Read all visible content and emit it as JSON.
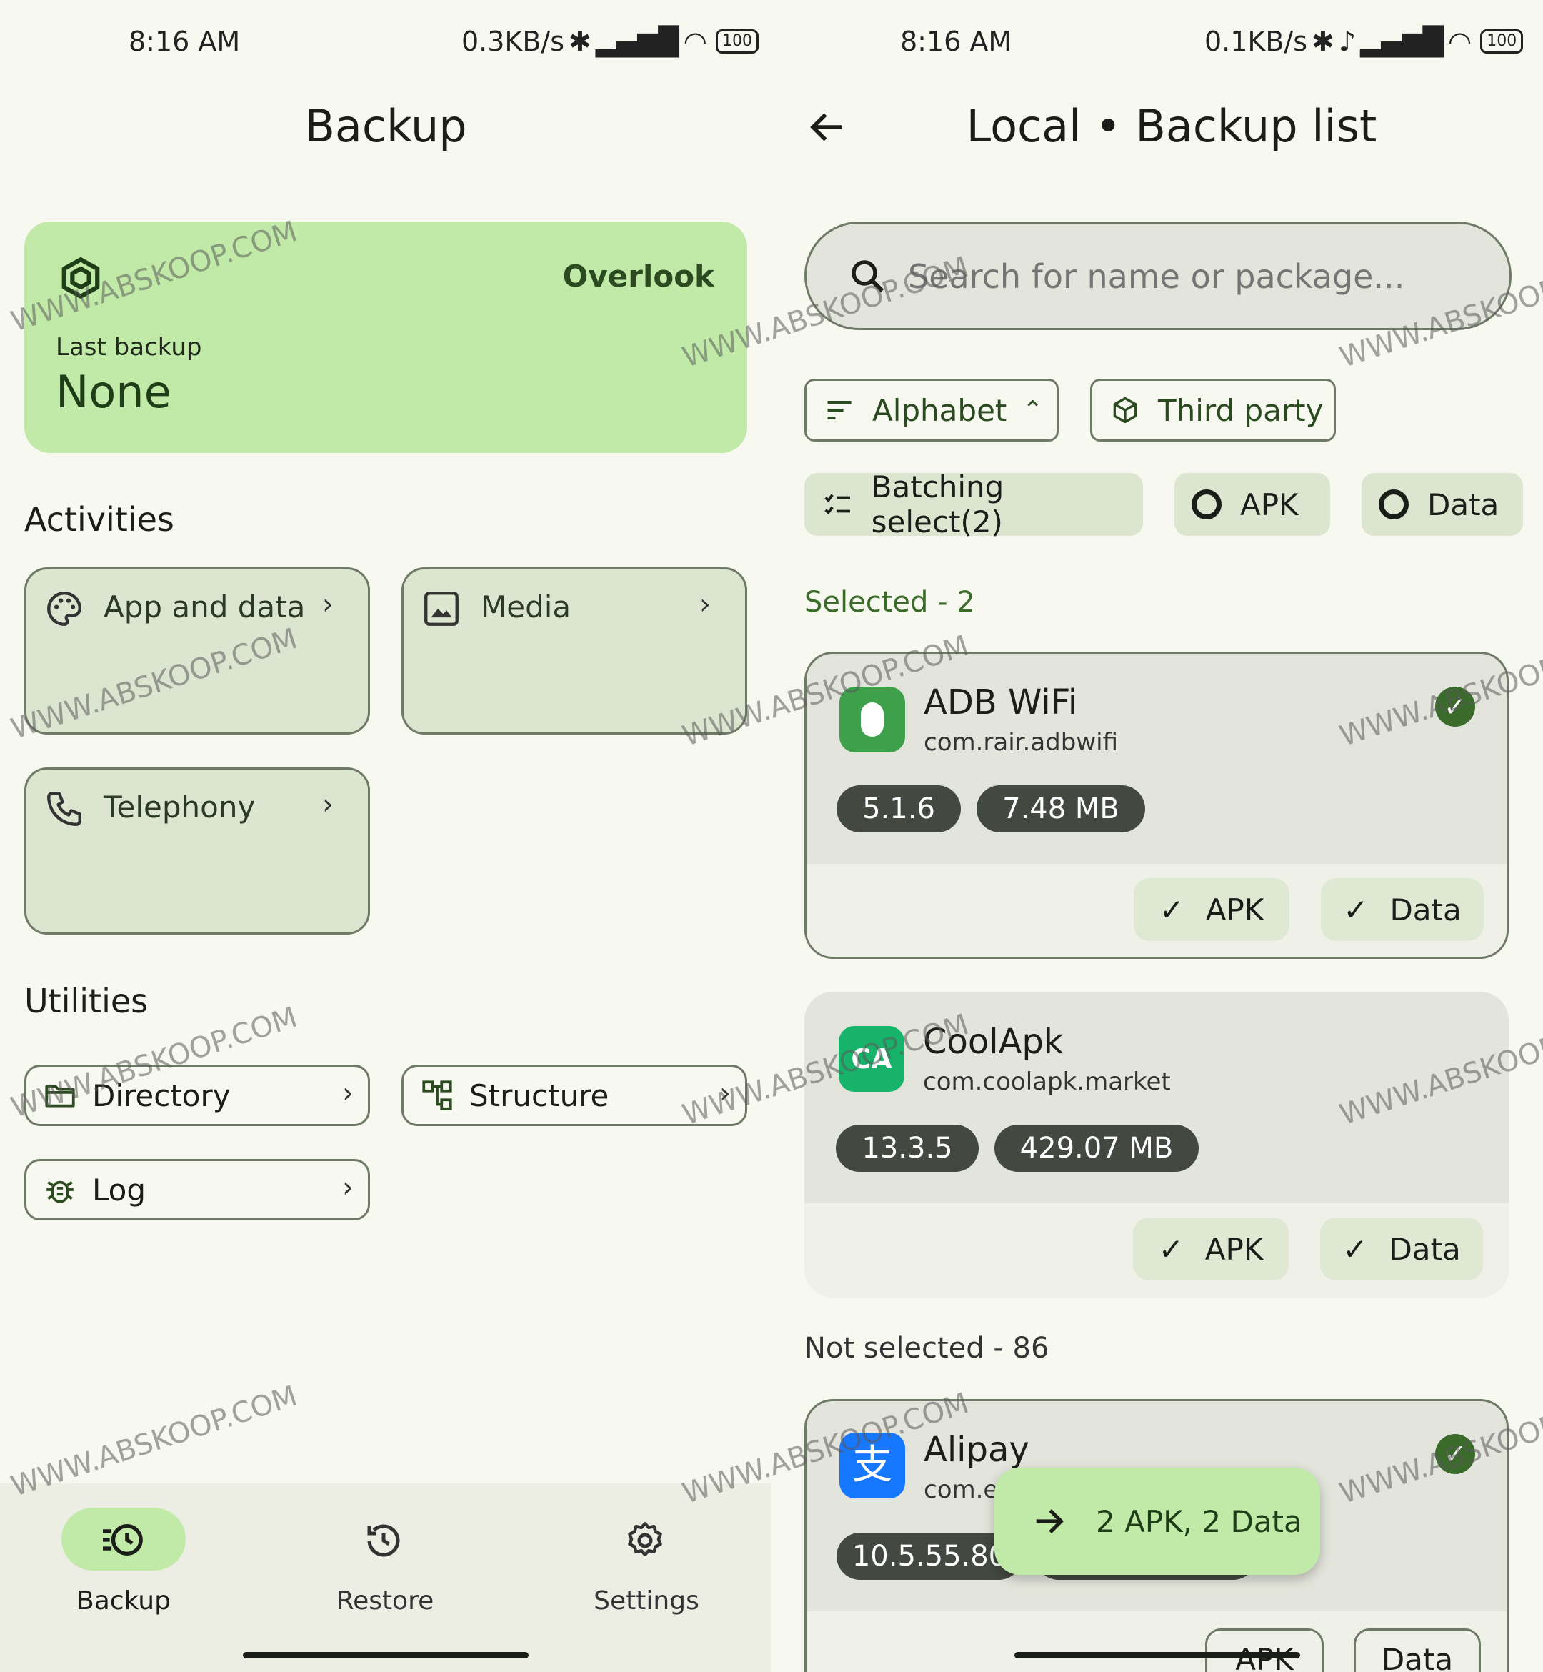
{
  "left": {
    "status": {
      "time": "8:16 AM",
      "speed": "0.3KB/s",
      "battery": "100"
    },
    "title": "Backup",
    "overlook": {
      "label": "Overlook",
      "last_backup_label": "Last backup",
      "last_backup_value": "None"
    },
    "activities": {
      "heading": "Activities",
      "items": [
        {
          "label": "App and data",
          "icon": "palette-icon"
        },
        {
          "label": "Media",
          "icon": "image-icon"
        },
        {
          "label": "Telephony",
          "icon": "phone-icon"
        }
      ]
    },
    "utilities": {
      "heading": "Utilities",
      "items": [
        {
          "label": "Directory",
          "icon": "folder-icon"
        },
        {
          "label": "Structure",
          "icon": "tree-icon"
        },
        {
          "label": "Log",
          "icon": "bug-icon"
        }
      ]
    },
    "nav": [
      {
        "label": "Backup",
        "icon": "backup-icon",
        "active": true
      },
      {
        "label": "Restore",
        "icon": "restore-icon",
        "active": false
      },
      {
        "label": "Settings",
        "icon": "gear-icon",
        "active": false
      }
    ]
  },
  "right": {
    "status": {
      "time": "8:16 AM",
      "speed": "0.1KB/s",
      "battery": "100"
    },
    "title": "Local • Backup list",
    "search": {
      "placeholder": "Search for name or package..."
    },
    "filters": {
      "sort": "Alphabet",
      "type": "Third party"
    },
    "chips": {
      "batch": "Batching select(2)",
      "apk": "APK",
      "data": "Data"
    },
    "selected_heading": "Selected - 2",
    "not_selected_heading": "Not selected - 86",
    "apps": [
      {
        "name": "ADB WiFi",
        "package": "com.rair.adbwifi",
        "version": "5.1.6",
        "size": "7.48 MB",
        "apk": "APK",
        "data": "Data",
        "color": "#3ea04a"
      },
      {
        "name": "CoolApk",
        "package": "com.coolapk.market",
        "version": "13.3.5",
        "size": "429.07 MB",
        "apk": "APK",
        "data": "Data",
        "color": "#17b36a"
      },
      {
        "name": "Alipay",
        "package": "com.eg",
        "version": "10.5.55.80",
        "apk": "APK",
        "data": "Data",
        "color": "#1677ff"
      }
    ],
    "fab": "2 APK, 2 Data"
  },
  "watermark": "WWW.ABSKOOP.COM",
  "colors": {
    "accent": "#c1eaa9",
    "tonal": "#dce5cf",
    "dark_tag": "#434840",
    "primary": "#3a6b2a"
  }
}
